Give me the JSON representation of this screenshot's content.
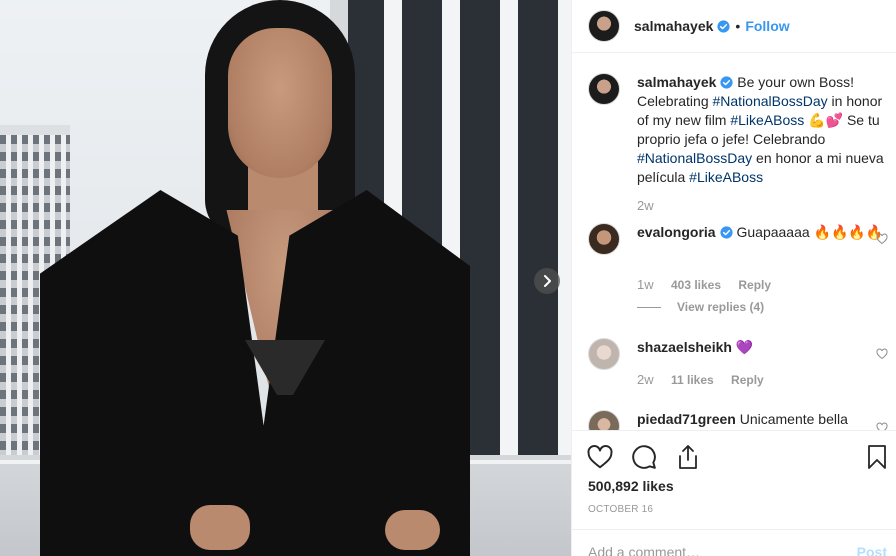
{
  "header": {
    "username": "salmahayek",
    "separator": "•",
    "follow_label": "Follow"
  },
  "caption": {
    "username": "salmahayek",
    "text_1": " Be your own Boss! Celebrating ",
    "tag_1": "#NationalBossDay",
    "text_2": " in honor of my new film ",
    "tag_2": "#LikeABoss",
    "text_3": " 💪💕 Se tu proprio jefa o jefe! Celebrando ",
    "tag_3": "#NationalBossDay",
    "text_4": " en honor a mi nueva película ",
    "tag_4": "#LikeABoss",
    "time": "2w"
  },
  "comments": [
    {
      "username": "evalongoria",
      "verified": true,
      "text": " Guapaaaaa 🔥🔥🔥🔥",
      "time": "1w",
      "likes": "403 likes",
      "reply_label": "Reply",
      "view_replies": "View replies (4)"
    },
    {
      "username": "shazaelsheikh",
      "verified": false,
      "text": " 💜",
      "time": "2w",
      "likes": "11 likes",
      "reply_label": "Reply"
    },
    {
      "username": "piedad71green",
      "verified": false,
      "text": " Unicamente bella"
    }
  ],
  "post": {
    "likes": "500,892 likes",
    "date": "OCTOBER 16",
    "comment_placeholder": "Add a comment…",
    "post_label": "Post"
  },
  "icons": {
    "like": "heart-icon",
    "comment": "comment-icon",
    "share": "share-icon",
    "save": "bookmark-icon",
    "next": "chevron-right-icon",
    "verified": "verified-badge-icon"
  },
  "colors": {
    "link": "#3897f0",
    "hashtag": "#003569",
    "muted": "#999999",
    "post_disabled": "#b2dffc"
  }
}
